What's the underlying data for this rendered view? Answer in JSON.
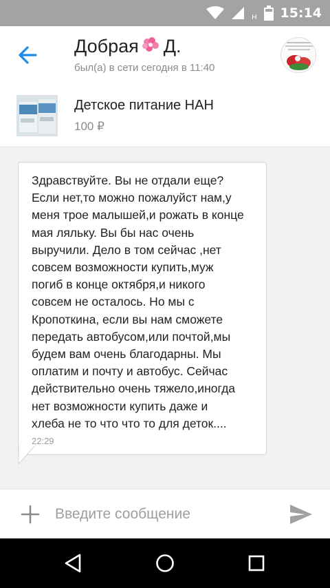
{
  "status_bar": {
    "time": "15:14",
    "network_label": "H",
    "icons": [
      "wifi-icon",
      "signal-icon",
      "battery-icon"
    ]
  },
  "header": {
    "contact_name_part1": "Добрая",
    "contact_name_part2": "Д.",
    "contact_status": "был(а) в сети сегодня в 11:40",
    "accent_color": "#1e88e5"
  },
  "product": {
    "title": "Детское питание НАН",
    "price": "100 ₽"
  },
  "messages": [
    {
      "text": "Здравствуйте. Вы не отдали еще?\nЕсли нет,то можно пожалуйст нам,у\nменя трое малышей,и рожать в конце\nмая ляльку. Вы бы нас очень\nвыручили. Дело в том сейчас ,нет\nсовсем возможности купить,муж\nпогиб в конце октября,и никого\nсовсем не осталось. Но мы с\nКропоткина, если вы нам сможете\nпередать автобусом,или почтой,мы\nбудем вам очень благодарны. Мы\nоплатим и почту и автобус. Сейчас\nдействительно очень тяжело,иногда\nнет возможности купить даже и\nхлеба не то что что то для деток....",
      "time": "22:29"
    }
  ],
  "input": {
    "placeholder": "Введите сообщение"
  }
}
